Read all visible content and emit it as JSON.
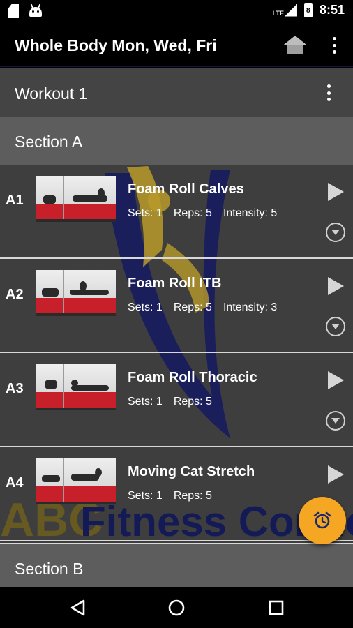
{
  "status_bar": {
    "icons": [
      "sd-card-icon",
      "android-icon",
      "signal-icon",
      "battery-icon"
    ],
    "network": "LTE",
    "battery_level": "8",
    "time": "8:51"
  },
  "app_bar": {
    "title": "Whole Body Mon, Wed, Fri",
    "icons": [
      "home-icon",
      "overflow-menu-icon"
    ]
  },
  "workout": {
    "label": "Workout 1"
  },
  "sections": [
    {
      "label": "Section A"
    },
    {
      "label": "Section B"
    }
  ],
  "exercises": [
    {
      "code": "A1",
      "name": "Foam Roll Calves",
      "sets": "Sets: 1",
      "reps": "Reps: 5",
      "intensity": "Intensity: 5"
    },
    {
      "code": "A2",
      "name": "Foam Roll ITB",
      "sets": "Sets: 1",
      "reps": "Reps: 5",
      "intensity": "Intensity: 3"
    },
    {
      "code": "A3",
      "name": "Foam Roll Thoracic",
      "sets": "Sets: 1",
      "reps": "Reps: 5"
    },
    {
      "code": "A4",
      "name": "Moving Cat Stretch",
      "sets": "Sets: 1",
      "reps": "Reps: 5"
    }
  ],
  "watermark": {
    "text": "ABC Fitness Connection",
    "colors": {
      "navy": "#1a1f5c",
      "gold": "#b89a2a"
    }
  },
  "fab": {
    "icon": "alarm-clock-icon",
    "color": "#f5a623"
  },
  "nav_bar": {
    "icons": [
      "back-icon",
      "home-circle-icon",
      "recents-icon"
    ]
  },
  "colors": {
    "background": "#3e3e3e",
    "section_header": "#5d5d5d",
    "workout_header": "#444444",
    "app_bar": "#000000"
  }
}
